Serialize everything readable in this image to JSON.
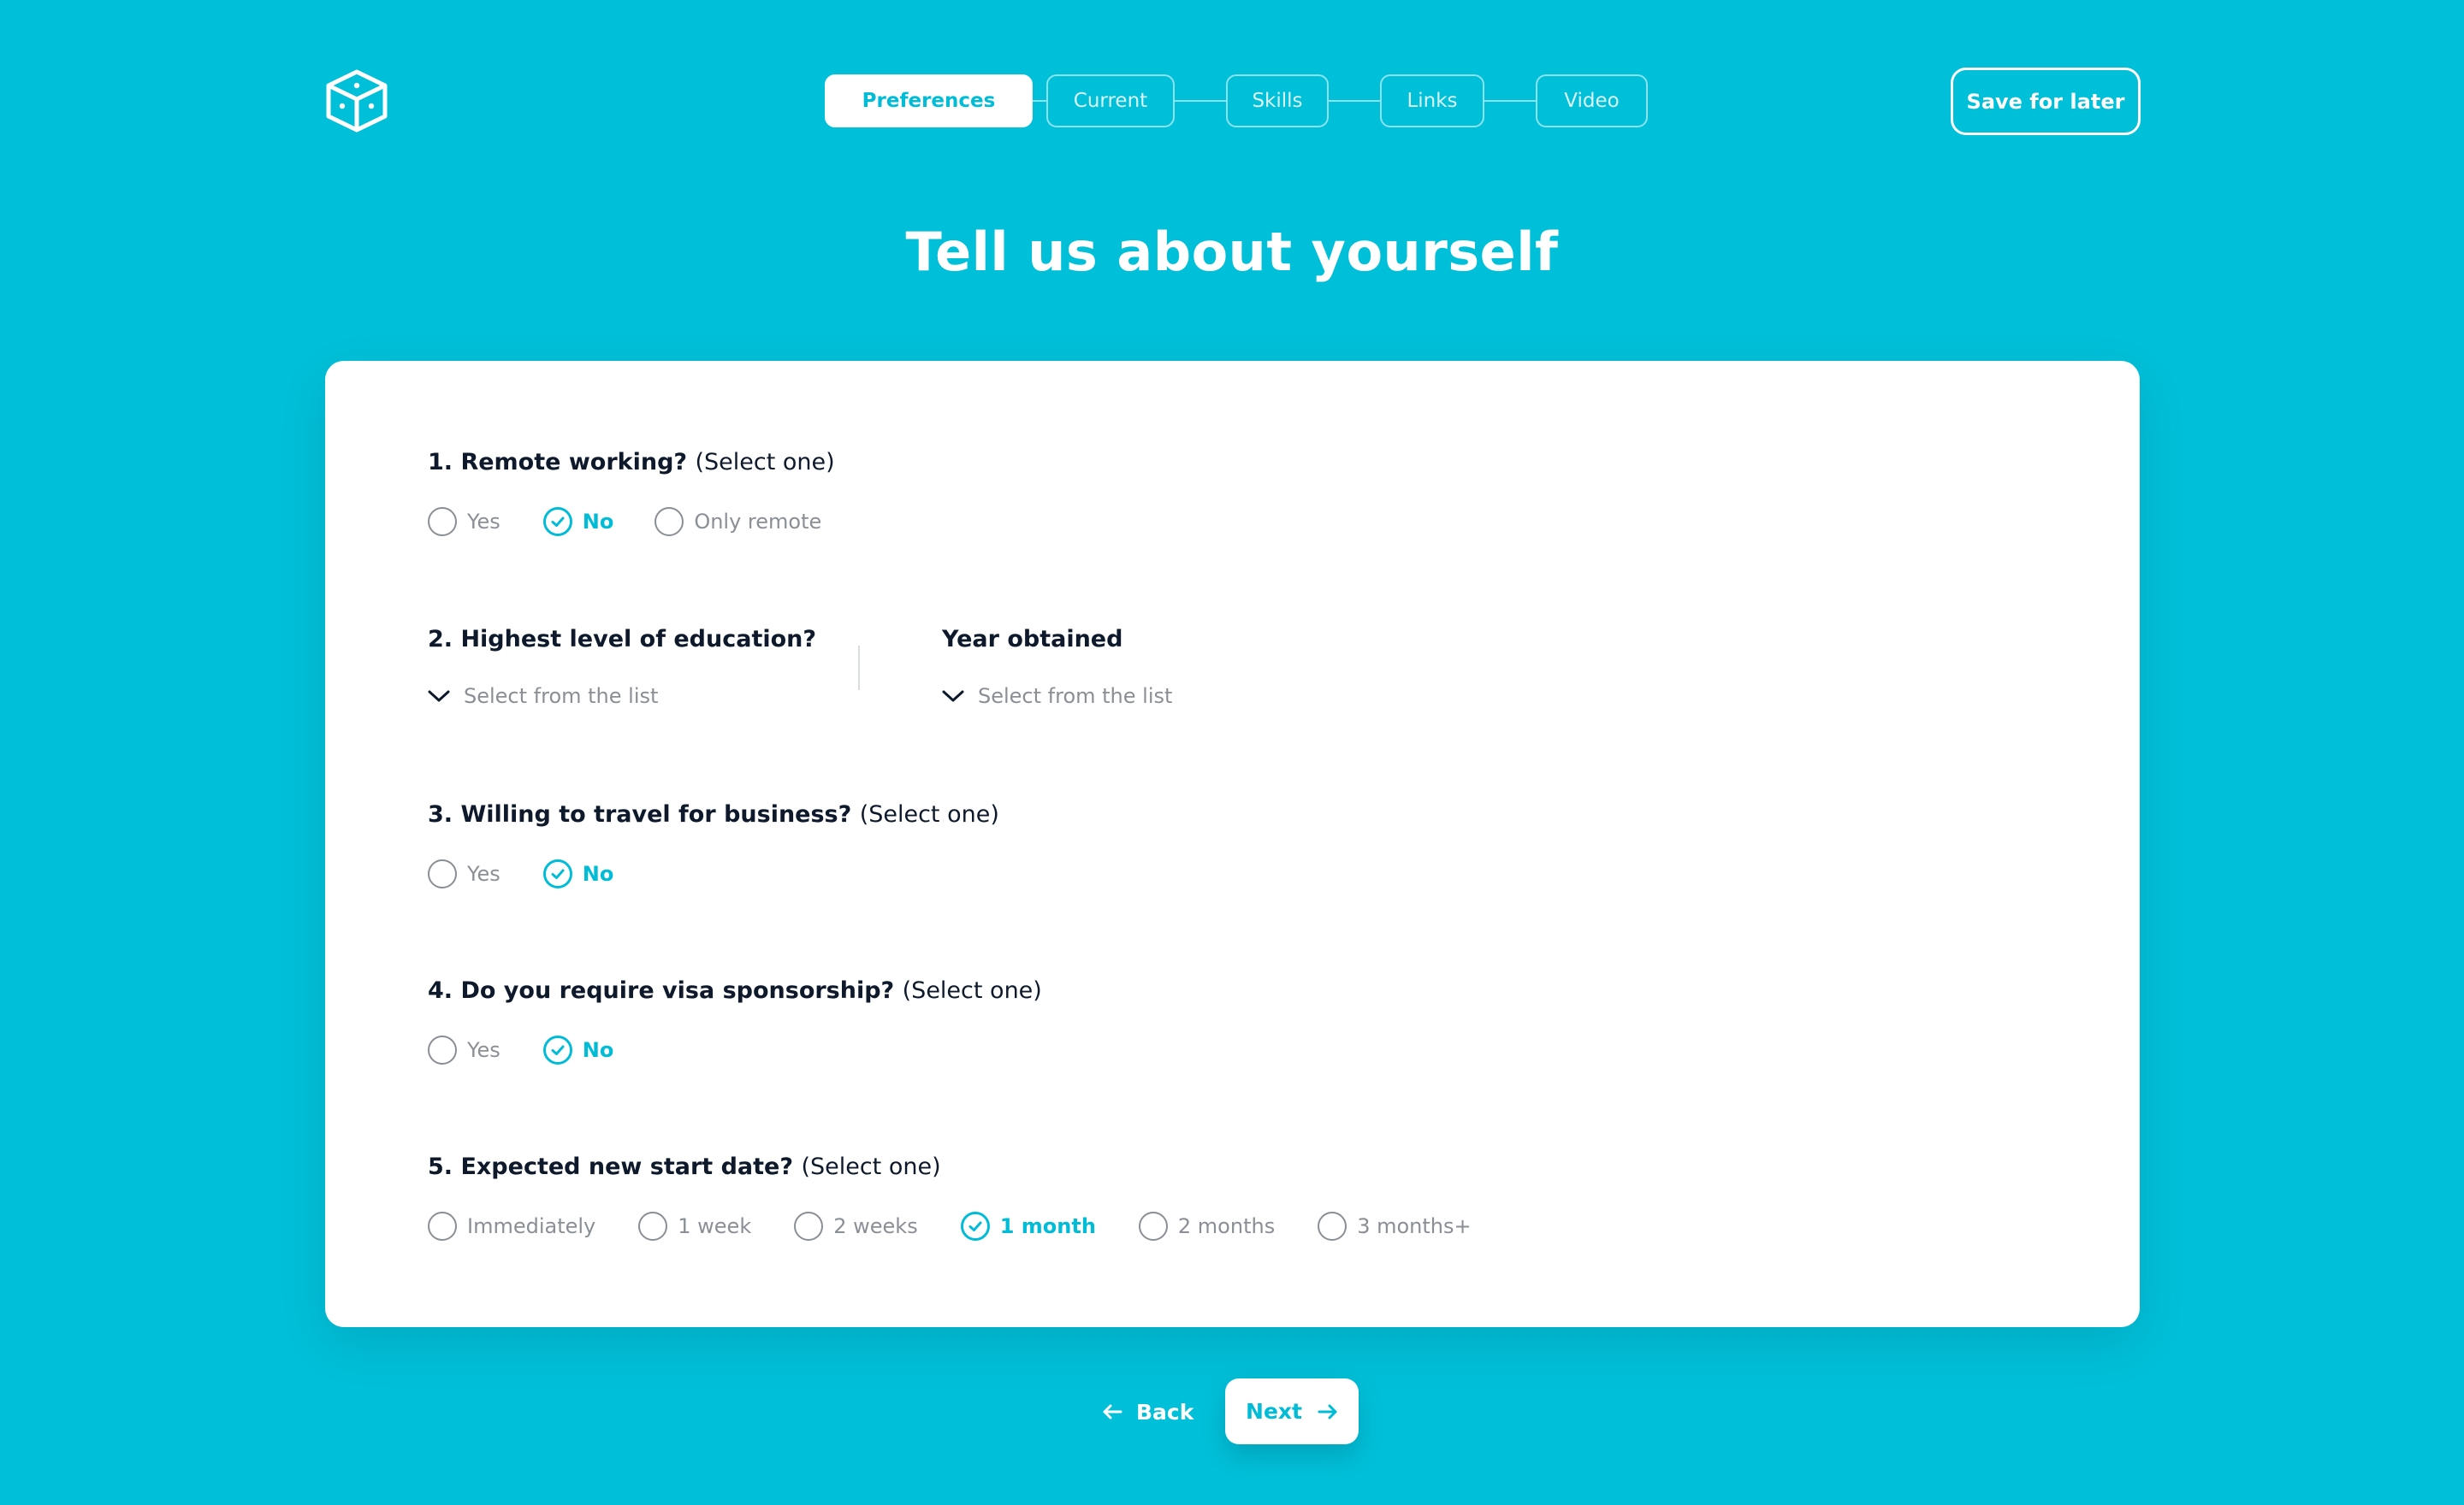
{
  "header": {
    "logo_icon": "cube-icon",
    "steps": [
      {
        "label": "Preferences",
        "active": true
      },
      {
        "label": "Current",
        "active": false
      },
      {
        "label": "Skills",
        "active": false
      },
      {
        "label": "Links",
        "active": false
      },
      {
        "label": "Video",
        "active": false
      }
    ],
    "save_label": "Save for later"
  },
  "title": "Tell us about yourself",
  "questions": {
    "q1": {
      "label": "1. Remote working?",
      "hint": "(Select one)",
      "options": [
        "Yes",
        "No",
        "Only remote"
      ],
      "selected": "No"
    },
    "q2": {
      "label": "2. Highest level of education?",
      "placeholder": "Select from the list",
      "year_label": "Year obtained",
      "year_placeholder": "Select from the list"
    },
    "q3": {
      "label": "3. Willing to travel for business?",
      "hint": "(Select one)",
      "options": [
        "Yes",
        "No"
      ],
      "selected": "No"
    },
    "q4": {
      "label": "4. Do you require visa sponsorship?",
      "hint": "(Select one)",
      "options": [
        "Yes",
        "No"
      ],
      "selected": "No"
    },
    "q5": {
      "label": "5. Expected new start date?",
      "hint": "(Select one)",
      "options": [
        "Immediately",
        "1 week",
        "2 weeks",
        "1 month",
        "2 months",
        "3 months+"
      ],
      "selected": "1 month"
    }
  },
  "nav": {
    "back_label": "Back",
    "next_label": "Next"
  },
  "colors": {
    "background": "#00c0d9",
    "accent": "#00bcd6",
    "text": "#0e1a2b",
    "muted": "#8a8f96"
  }
}
